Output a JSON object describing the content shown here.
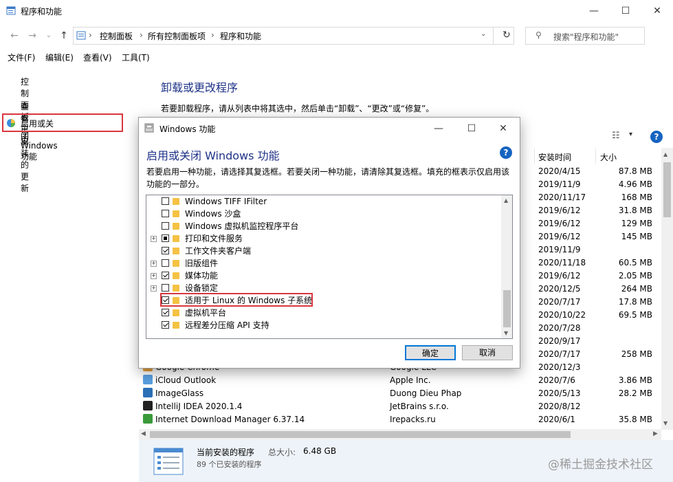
{
  "window": {
    "title": "程序和功能"
  },
  "address": {
    "crumbs": [
      "控制面板",
      "所有控制面板项",
      "程序和功能"
    ],
    "search_placeholder": "搜索\"程序和功能\""
  },
  "menu": [
    "文件(F)",
    "编辑(E)",
    "查看(V)",
    "工具(T)"
  ],
  "sidebar": {
    "items": [
      "控制面板主页",
      "查看已安装的更新",
      "启用或关闭 Windows 功能"
    ]
  },
  "main": {
    "heading": "卸载或更改程序",
    "description": "若要卸载程序，请从列表中将其选中，然后单击“卸载”、“更改”或“修复”。",
    "columns": {
      "date": "安装时间",
      "size": "大小"
    },
    "dates": [
      "2020/4/15",
      "2019/11/9",
      "2020/11/17",
      "2019/6/12",
      "2019/6/12",
      "2019/6/12",
      "2019/11/9",
      "2020/11/18",
      "2019/6/12",
      "2020/12/5",
      "2020/7/17",
      "2020/10/22",
      "2020/7/28",
      "2020/9/17",
      "2020/7/17",
      "2020/12/3",
      "2020/7/6",
      "2020/5/13",
      "2020/8/12",
      "2020/6/1"
    ],
    "sizes": [
      "87.8 MB",
      "4.96 MB",
      "168 MB",
      "31.8 MB",
      "129 MB",
      "145 MB",
      "",
      "60.5 MB",
      "2.05 MB",
      "264 MB",
      "17.8 MB",
      "69.5 MB",
      "",
      "",
      "258 MB",
      "",
      "3.86 MB",
      "28.2 MB",
      "",
      "35.8 MB"
    ],
    "programs": [
      {
        "name": "Google Chrome",
        "publisher": "Google LLC"
      },
      {
        "name": "iCloud Outlook",
        "publisher": "Apple Inc."
      },
      {
        "name": "ImageGlass",
        "publisher": "Duong Dieu Phap"
      },
      {
        "name": "IntelliJ IDEA 2020.1.4",
        "publisher": "JetBrains s.r.o."
      },
      {
        "name": "Internet Download Manager 6.37.14",
        "publisher": "Irepacks.ru"
      }
    ]
  },
  "status": {
    "label": "当前安装的程序",
    "total_label": "总大小:",
    "total": "6.48 GB",
    "count": "89 个已安装的程序"
  },
  "watermark": "@稀土掘金技术社区",
  "dialog": {
    "title": "Windows 功能",
    "heading": "启用或关闭 Windows 功能",
    "description": "若要启用一种功能，请选择其复选框。若要关闭一种功能，请清除其复选框。填充的框表示仅启用该功能的一部分。",
    "features": [
      {
        "label": "Windows TIFF IFilter",
        "state": "unchecked",
        "expandable": false
      },
      {
        "label": "Windows 沙盒",
        "state": "unchecked",
        "expandable": false
      },
      {
        "label": "Windows 虚拟机监控程序平台",
        "state": "unchecked",
        "expandable": false
      },
      {
        "label": "打印和文件服务",
        "state": "partial",
        "expandable": true
      },
      {
        "label": "工作文件夹客户端",
        "state": "checked",
        "expandable": false
      },
      {
        "label": "旧版组件",
        "state": "unchecked",
        "expandable": true
      },
      {
        "label": "媒体功能",
        "state": "checked",
        "expandable": true
      },
      {
        "label": "设备锁定",
        "state": "unchecked",
        "expandable": true
      },
      {
        "label": "适用于 Linux 的 Windows 子系统",
        "state": "checked",
        "expandable": false
      },
      {
        "label": "虚拟机平台",
        "state": "checked",
        "expandable": false
      },
      {
        "label": "远程差分压缩 API 支持",
        "state": "checked",
        "expandable": false
      }
    ],
    "ok_label": "确定",
    "cancel_label": "取消"
  }
}
